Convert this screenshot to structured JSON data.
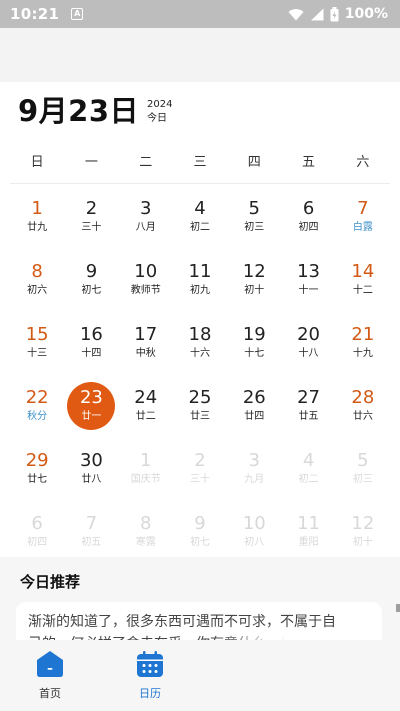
{
  "status_bar": {
    "time": "10:21",
    "app_icon": "A",
    "battery": "100%"
  },
  "header": {
    "date": "9月23日",
    "year": "2024",
    "today_label": "今日"
  },
  "weekdays": [
    "日",
    "一",
    "二",
    "三",
    "四",
    "五",
    "六"
  ],
  "weeks": [
    [
      {
        "num": "1",
        "lunar": "廿九"
      },
      {
        "num": "2",
        "lunar": "三十"
      },
      {
        "num": "3",
        "lunar": "八月"
      },
      {
        "num": "4",
        "lunar": "初二"
      },
      {
        "num": "5",
        "lunar": "初三"
      },
      {
        "num": "6",
        "lunar": "初四"
      },
      {
        "num": "7",
        "lunar": "白露"
      }
    ],
    [
      {
        "num": "8",
        "lunar": "初六"
      },
      {
        "num": "9",
        "lunar": "初七"
      },
      {
        "num": "10",
        "lunar": "教师节"
      },
      {
        "num": "11",
        "lunar": "初九"
      },
      {
        "num": "12",
        "lunar": "初十"
      },
      {
        "num": "13",
        "lunar": "十一"
      },
      {
        "num": "14",
        "lunar": "十二"
      }
    ],
    [
      {
        "num": "15",
        "lunar": "十三"
      },
      {
        "num": "16",
        "lunar": "十四"
      },
      {
        "num": "17",
        "lunar": "中秋"
      },
      {
        "num": "18",
        "lunar": "十六"
      },
      {
        "num": "19",
        "lunar": "十七"
      },
      {
        "num": "20",
        "lunar": "十八"
      },
      {
        "num": "21",
        "lunar": "十九"
      }
    ],
    [
      {
        "num": "22",
        "lunar": "秋分"
      },
      {
        "num": "23",
        "lunar": "廿一"
      },
      {
        "num": "24",
        "lunar": "廿二"
      },
      {
        "num": "25",
        "lunar": "廿三"
      },
      {
        "num": "26",
        "lunar": "廿四"
      },
      {
        "num": "27",
        "lunar": "廿五"
      },
      {
        "num": "28",
        "lunar": "廿六"
      }
    ],
    [
      {
        "num": "29",
        "lunar": "廿七"
      },
      {
        "num": "30",
        "lunar": "廿八"
      },
      {
        "num": "1",
        "lunar": "国庆节"
      },
      {
        "num": "2",
        "lunar": "三十"
      },
      {
        "num": "3",
        "lunar": "九月"
      },
      {
        "num": "4",
        "lunar": "初二"
      },
      {
        "num": "5",
        "lunar": "初三"
      }
    ],
    [
      {
        "num": "6",
        "lunar": "初四"
      },
      {
        "num": "7",
        "lunar": "初五"
      },
      {
        "num": "8",
        "lunar": "寒露"
      },
      {
        "num": "9",
        "lunar": "初七"
      },
      {
        "num": "10",
        "lunar": "初八"
      },
      {
        "num": "11",
        "lunar": "重阳"
      },
      {
        "num": "12",
        "lunar": "初十"
      }
    ]
  ],
  "recommend": {
    "title": "今日推荐",
    "line1": "渐渐的知道了，很多东西可遇而不可求，不属于自",
    "line2": "己的，何必拼了命去在乎，你有意什么，什么就会"
  },
  "nav": {
    "home": "首页",
    "calendar": "日历"
  },
  "colors": {
    "accent": "#e05a13",
    "weekend": "#d35a15",
    "term": "#3c8fc9",
    "nav_active": "#1f76d2"
  }
}
